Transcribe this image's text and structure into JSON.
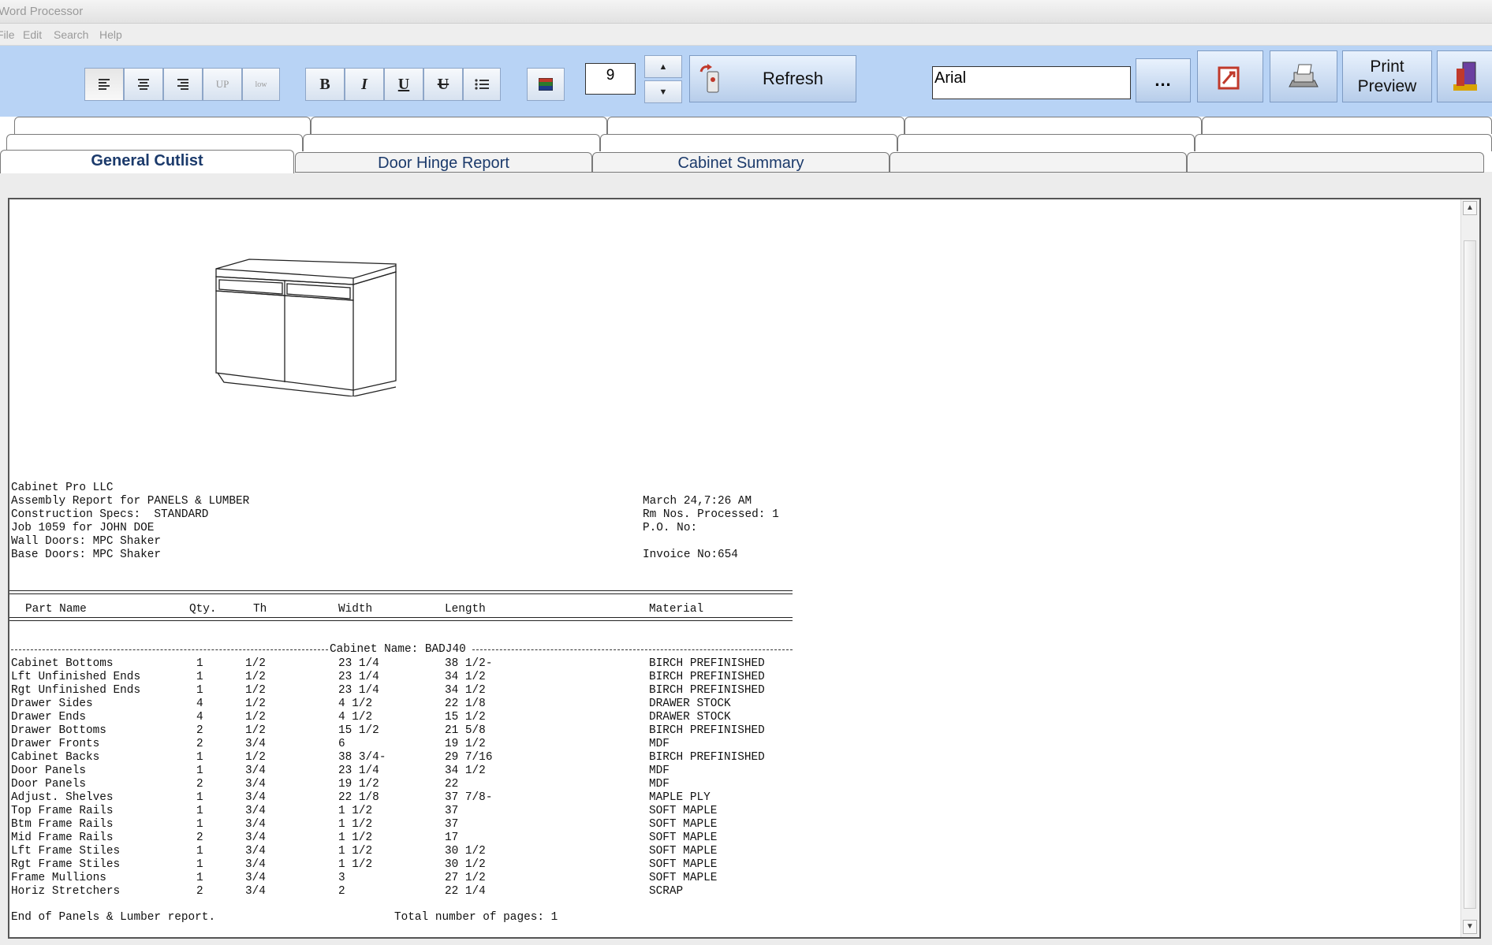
{
  "window": {
    "title": "Word Processor"
  },
  "menu": {
    "items": [
      "File",
      "Edit",
      "Search",
      "Help"
    ]
  },
  "toolbar": {
    "align_up_label": "UP",
    "align_low_label": "low",
    "bold_label": "B",
    "italic_label": "I",
    "underline_label": "U",
    "strike_label": "U",
    "font_size": "9",
    "refresh_label": "Refresh",
    "font_name": "Arial",
    "more_label": "...",
    "print_preview_label_1": "Print",
    "print_preview_label_2": "Preview"
  },
  "tabs": {
    "front": [
      {
        "label": "General Cutlist",
        "active": true
      },
      {
        "label": "Door Hinge Report",
        "active": false
      },
      {
        "label": "Cabinet Summary",
        "active": false
      },
      {
        "label": "",
        "active": false
      },
      {
        "label": "",
        "active": false
      }
    ]
  },
  "report": {
    "header_left": [
      "Cabinet Pro LLC",
      "Assembly Report for PANELS & LUMBER",
      "Construction Specs:  STANDARD",
      "Job 1059 for JOHN DOE",
      "Wall Doors: MPC Shaker",
      "Base Doors: MPC Shaker"
    ],
    "header_right": {
      "date": "March 24,7:26 AM",
      "rm_nos": "Rm Nos. Processed: 1",
      "po": "P.O. No:",
      "invoice": "Invoice No:654"
    },
    "columns": [
      "Part Name",
      "Qty.",
      "Th",
      "Width",
      "Length",
      "Material"
    ],
    "cabinet_name": "Cabinet Name: BADJ40",
    "rows": [
      [
        "Cabinet Bottoms",
        "1",
        "1/2",
        "23 1/4",
        "38 1/2-",
        "BIRCH PREFINISHED"
      ],
      [
        "Lft Unfinished Ends",
        "1",
        "1/2",
        "23 1/4",
        "34 1/2",
        "BIRCH PREFINISHED"
      ],
      [
        "Rgt Unfinished Ends",
        "1",
        "1/2",
        "23 1/4",
        "34 1/2",
        "BIRCH PREFINISHED"
      ],
      [
        "Drawer Sides",
        "4",
        "1/2",
        "4 1/2",
        "22 1/8",
        "DRAWER STOCK"
      ],
      [
        "Drawer Ends",
        "4",
        "1/2",
        "4 1/2",
        "15 1/2",
        "DRAWER STOCK"
      ],
      [
        "Drawer Bottoms",
        "2",
        "1/2",
        "15 1/2",
        "21 5/8",
        "BIRCH PREFINISHED"
      ],
      [
        "Drawer Fronts",
        "2",
        "3/4",
        "6",
        "19 1/2",
        "MDF"
      ],
      [
        "Cabinet Backs",
        "1",
        "1/2",
        "38 3/4-",
        "29 7/16",
        "BIRCH PREFINISHED"
      ],
      [
        "Door Panels",
        "1",
        "3/4",
        "23 1/4",
        "34 1/2",
        "MDF"
      ],
      [
        "Door Panels",
        "2",
        "3/4",
        "19 1/2",
        "22",
        "MDF"
      ],
      [
        "Adjust. Shelves",
        "1",
        "3/4",
        "22 1/8",
        "37 7/8-",
        "MAPLE PLY"
      ],
      [
        "Top Frame Rails",
        "1",
        "3/4",
        "1 1/2",
        "37",
        "SOFT MAPLE"
      ],
      [
        "Btm Frame Rails",
        "1",
        "3/4",
        "1 1/2",
        "37",
        "SOFT MAPLE"
      ],
      [
        "Mid Frame Rails",
        "2",
        "3/4",
        "1 1/2",
        "17",
        "SOFT MAPLE"
      ],
      [
        "Lft Frame Stiles",
        "1",
        "3/4",
        "1 1/2",
        "30 1/2",
        "SOFT MAPLE"
      ],
      [
        "Rgt Frame Stiles",
        "1",
        "3/4",
        "1 1/2",
        "30 1/2",
        "SOFT MAPLE"
      ],
      [
        "Frame Mullions",
        "1",
        "3/4",
        "3",
        "27 1/2",
        "SOFT MAPLE"
      ],
      [
        "Horiz Stretchers",
        "2",
        "3/4",
        "2",
        "22 1/4",
        "SCRAP"
      ]
    ],
    "footer_left": "End of Panels & Lumber report.",
    "footer_right": "Total number of pages: 1"
  }
}
